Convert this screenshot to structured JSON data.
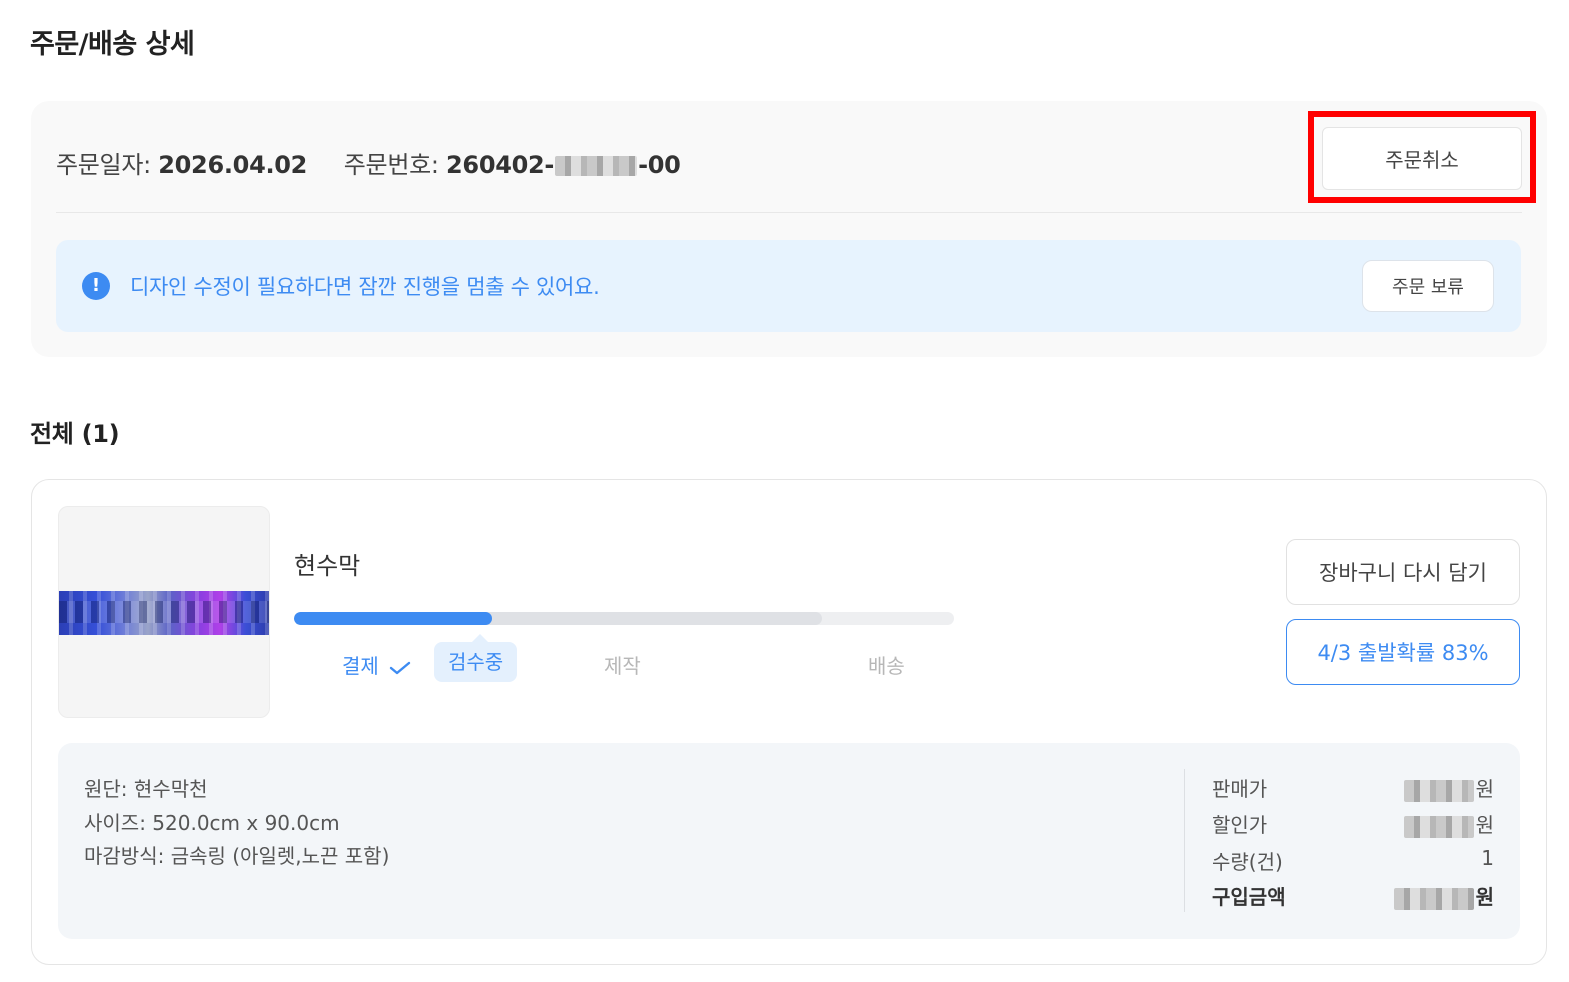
{
  "page": {
    "title": "주문/배송 상세"
  },
  "order": {
    "date_label": "주문일자:",
    "date_value": "2026.04.02",
    "number_label": "주문번호:",
    "number_prefix": "260402-",
    "number_suffix": "-00",
    "cancel_label": "주문취소"
  },
  "notice": {
    "icon": "info-icon",
    "icon_glyph": "!",
    "text": "디자인 수정이 필요하다면 잠깐 진행을 멈출 수 있어요.",
    "hold_label": "주문 보류"
  },
  "section": {
    "title": "전체 (1)"
  },
  "product": {
    "name": "현수막",
    "progress_fraction": 0.3,
    "buffer_fraction": 0.8,
    "steps": [
      {
        "label": "결제",
        "state": "done"
      },
      {
        "label": "검수중",
        "state": "current"
      },
      {
        "label": "제작",
        "state": "pending"
      },
      {
        "label": "배송",
        "state": "pending"
      }
    ],
    "recart_label": "장바구니 다시 담기",
    "depart_label": "4/3 출발확률 83%",
    "specs": [
      "원단: 현수막천",
      "사이즈: 520.0cm x 90.0cm",
      "마감방식: 금속링 (아일렛,노끈 포함)"
    ],
    "prices": [
      {
        "label": "판매가",
        "unit": "원"
      },
      {
        "label": "할인가",
        "unit": "원"
      },
      {
        "label": "수량(건)",
        "value": "1"
      },
      {
        "label": "구입금액",
        "unit": "원"
      }
    ]
  },
  "colors": {
    "accent": "#3d8bf2",
    "highlight": "#ff0000",
    "notice_bg": "#e7f3fe"
  }
}
